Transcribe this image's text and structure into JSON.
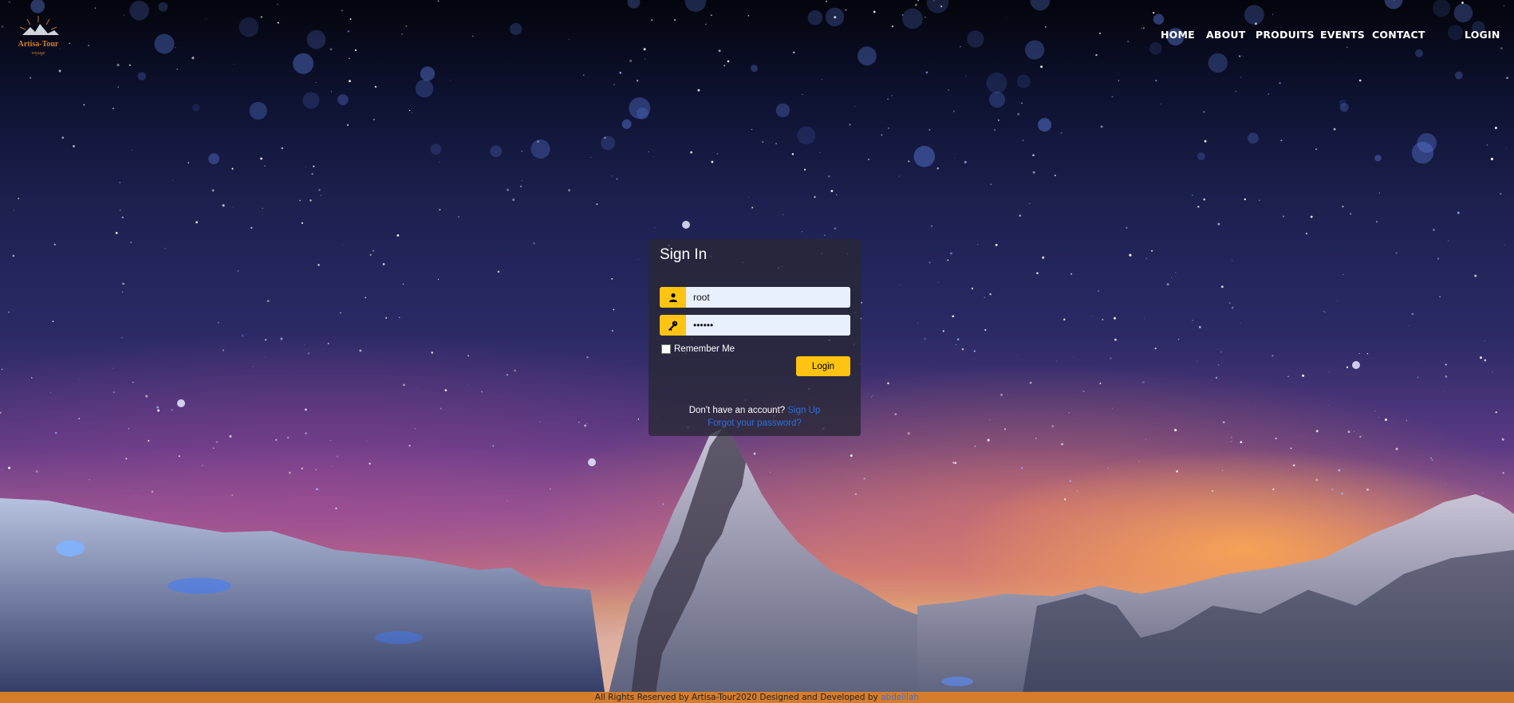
{
  "brand": {
    "logo_text": "Artisa-Tour",
    "logo_subtext": "voyage"
  },
  "nav": {
    "home": "HOME",
    "about": "ABOUT",
    "produits": "PRODUITS",
    "events": "EVENTS",
    "contact": "CONTACT",
    "login": "LOGIN"
  },
  "signin": {
    "title": "Sign In",
    "username_value": "root",
    "password_value": "••••••",
    "username_icon": "user-icon",
    "password_icon": "key-icon",
    "remember_label": "Remember Me",
    "remember_checked": false,
    "login_button": "Login",
    "no_account_text": "Don't have an account?",
    "signup_link": "Sign Up",
    "forgot_link": "Forgot your password?"
  },
  "footer": {
    "text": "All Rights Reserved by Artisa-Tour2020 Designed and Developed by",
    "author_link": "abdelilah"
  },
  "colors": {
    "accent": "#ffc312",
    "footer_bg": "#d67d2c",
    "link": "#2b6fde",
    "panel_bg": "rgba(40,40,52,0.78)"
  }
}
